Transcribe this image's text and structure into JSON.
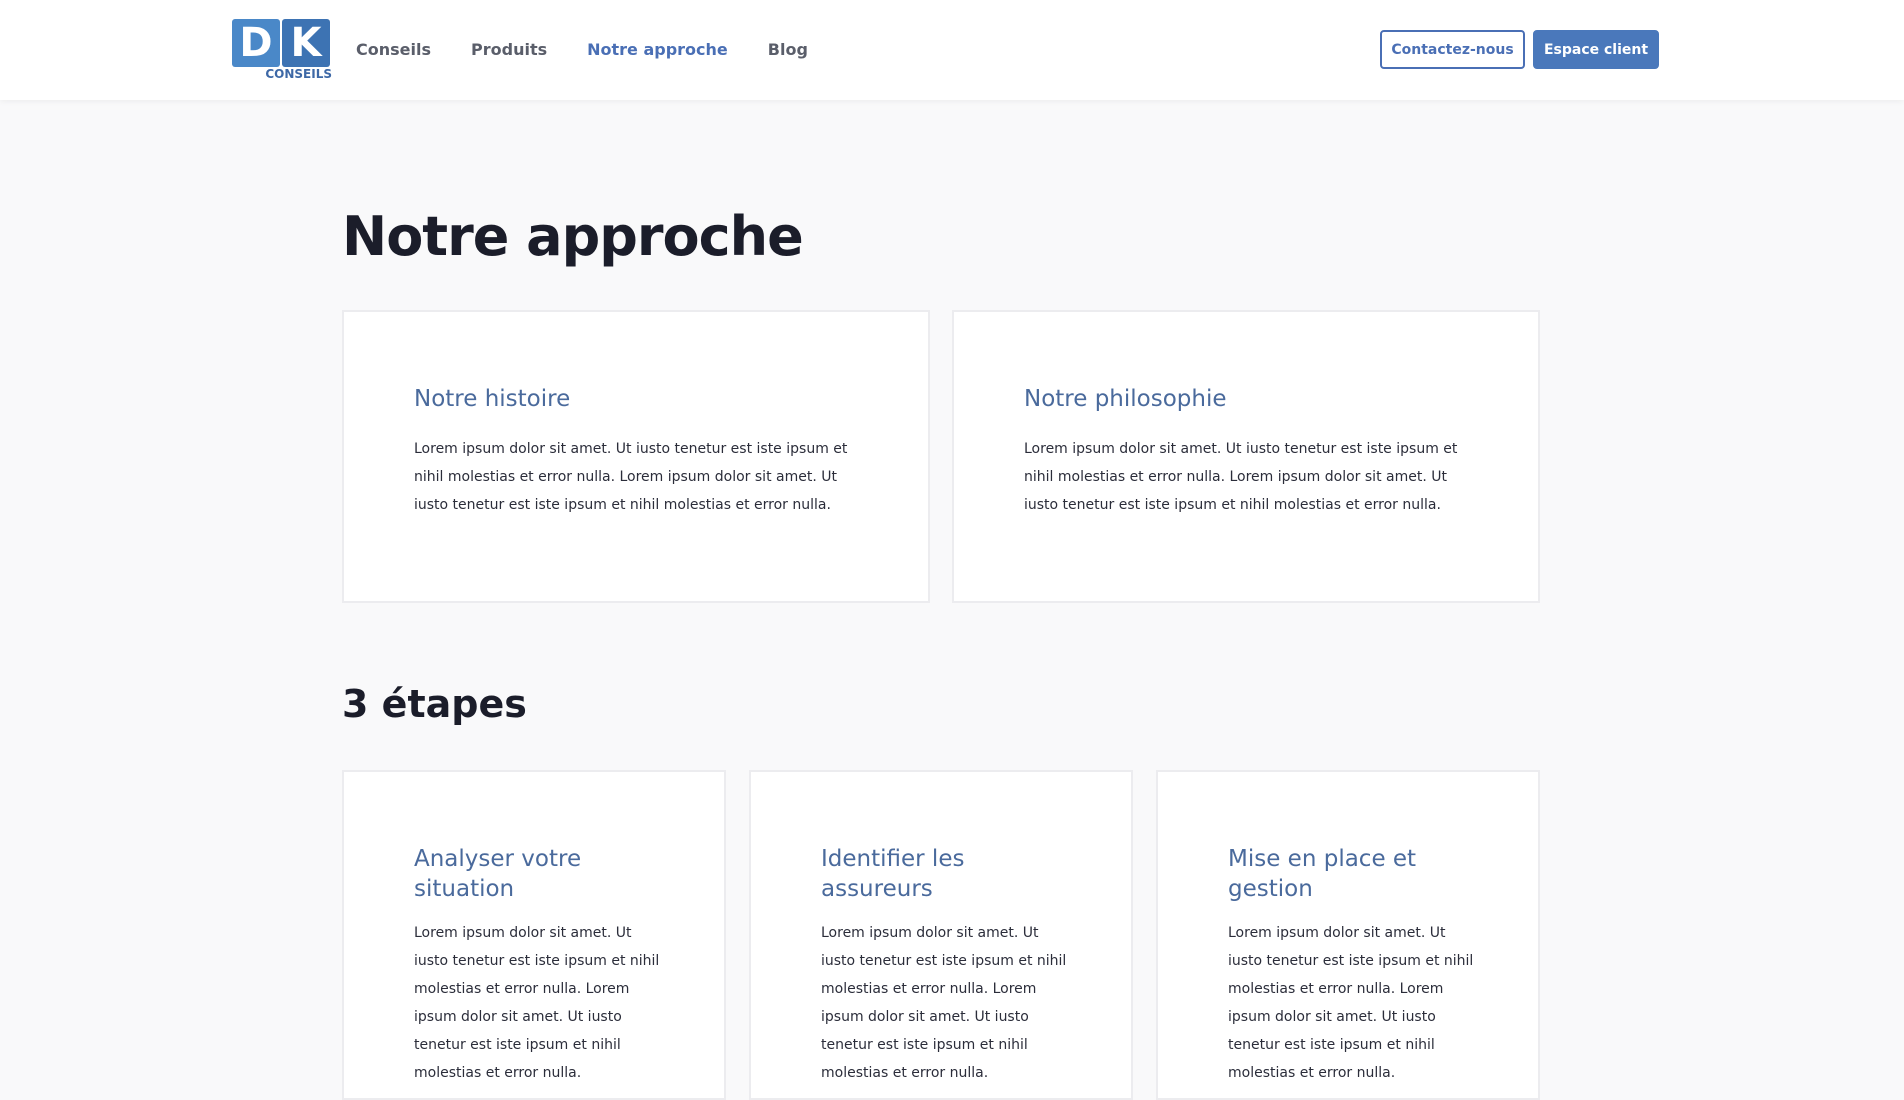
{
  "header": {
    "logo": {
      "letter1": "D",
      "letter2": "K",
      "subtitle": "CONSEILS"
    },
    "nav": [
      {
        "label": "Conseils",
        "active": false
      },
      {
        "label": "Produits",
        "active": false
      },
      {
        "label": "Notre approche",
        "active": true
      },
      {
        "label": "Blog",
        "active": false
      }
    ],
    "contact_label": "Contactez-nous",
    "client_label": "Espace client"
  },
  "main": {
    "title": "Notre approche",
    "intro_cards": [
      {
        "title": "Notre histoire",
        "text": "Lorem ipsum dolor sit amet. Ut iusto tenetur est iste ipsum et nihil molestias et error nulla. Lorem ipsum dolor sit amet. Ut iusto tenetur est iste ipsum et nihil molestias et error nulla."
      },
      {
        "title": "Notre philosophie",
        "text": "Lorem ipsum dolor sit amet. Ut iusto tenetur est iste ipsum et nihil molestias et error nulla. Lorem ipsum dolor sit amet. Ut iusto tenetur est iste ipsum et nihil molestias et error nulla."
      }
    ],
    "steps_title": "3 étapes",
    "steps": [
      {
        "title": "Analyser votre situation",
        "text": "Lorem ipsum dolor sit amet. Ut iusto tenetur est iste ipsum et nihil molestias et error nulla. Lorem ipsum dolor sit amet. Ut iusto tenetur est iste ipsum et nihil molestias et error nulla."
      },
      {
        "title": "Identifier les assureurs",
        "text": "Lorem ipsum dolor sit amet. Ut iusto tenetur est iste ipsum et nihil molestias et error nulla. Lorem ipsum dolor sit amet. Ut iusto tenetur est iste ipsum et nihil molestias et error nulla."
      },
      {
        "title": "Mise en place et gestion",
        "text": "Lorem ipsum dolor sit amet. Ut iusto tenetur est iste ipsum et nihil molestias et error nulla. Lorem ipsum dolor sit amet. Ut iusto tenetur est iste ipsum et nihil molestias et error nulla."
      }
    ]
  },
  "colors": {
    "accent": "#4a6fb5",
    "logo_blue": "#4a88c8",
    "background": "#f9f9fa",
    "heading": "#1b1d2a"
  }
}
